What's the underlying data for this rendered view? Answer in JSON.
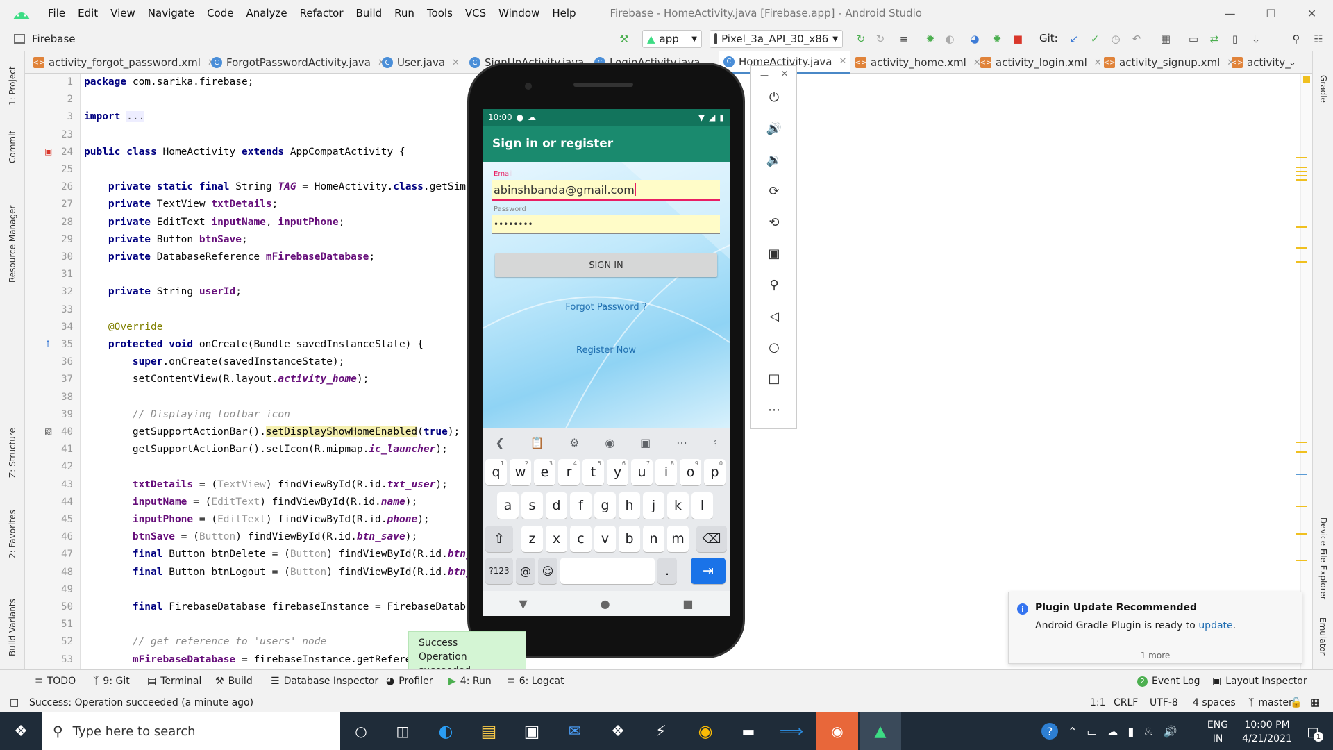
{
  "menubar": {
    "items": [
      "File",
      "Edit",
      "View",
      "Navigate",
      "Code",
      "Analyze",
      "Refactor",
      "Build",
      "Run",
      "Tools",
      "VCS",
      "Window",
      "Help"
    ],
    "title": "Firebase - HomeActivity.java [Firebase.app] - Android Studio"
  },
  "toolbar": {
    "project": "Firebase",
    "run_config": "app",
    "device": "Pixel_3a_API_30_x86",
    "git_label": "Git:"
  },
  "tabs": [
    {
      "label": "activity_forgot_password.xml",
      "type": "xml"
    },
    {
      "label": "ForgotPasswordActivity.java",
      "type": "java"
    },
    {
      "label": "User.java",
      "type": "java"
    },
    {
      "label": "SignUpActivity.java",
      "type": "java"
    },
    {
      "label": "LoginActivity.java",
      "type": "java"
    },
    {
      "label": "HomeActivity.java",
      "type": "java"
    },
    {
      "label": "activity_home.xml",
      "type": "xml"
    },
    {
      "label": "activity_login.xml",
      "type": "xml"
    },
    {
      "label": "activity_signup.xml",
      "type": "xml"
    },
    {
      "label": "activity_",
      "type": "xml"
    }
  ],
  "left_tools": [
    "1: Project",
    "Commit",
    "Resource Manager",
    "Z: Structure",
    "2: Favorites",
    "Build Variants"
  ],
  "right_tools": [
    "Gradle",
    "Device File Explorer",
    "Emulator"
  ],
  "code_lines": [
    {
      "n": "1",
      "html": "<span class='kw'>package</span> com.sarika.firebase;"
    },
    {
      "n": "2",
      "html": ""
    },
    {
      "n": "3",
      "html": "<span class='kw'>import</span> <span style='color:#555;background:#eef'>...</span>"
    },
    {
      "n": "23",
      "html": ""
    },
    {
      "n": "24",
      "html": "<span class='kw'>public class</span> HomeActivity <span class='kw'>extends</span> AppCompatActivity {"
    },
    {
      "n": "25",
      "html": ""
    },
    {
      "n": "26",
      "html": "    <span class='kw'>private static final</span> String <span class='it'>TAG</span> = HomeActivity.<span class='kw'>class</span>.getSimpleName();"
    },
    {
      "n": "27",
      "html": "    <span class='kw'>private</span> TextView <span class='fld'>txtDetails</span>;"
    },
    {
      "n": "28",
      "html": "    <span class='kw'>private</span> EditText <span class='fld'>inputName</span>, <span class='fld'>inputPhone</span>;"
    },
    {
      "n": "29",
      "html": "    <span class='kw'>private</span> Button <span class='fld'>btnSave</span>;"
    },
    {
      "n": "30",
      "html": "    <span class='kw'>private</span> DatabaseReference <span class='fld'>mFirebaseDatabase</span>;"
    },
    {
      "n": "31",
      "html": ""
    },
    {
      "n": "32",
      "html": "    <span class='kw'>private</span> String <span class='fld'>userId</span>;"
    },
    {
      "n": "33",
      "html": ""
    },
    {
      "n": "34",
      "html": "    <span class='an'>@Override</span>"
    },
    {
      "n": "35",
      "html": "    <span class='kw'>protected void</span> onCreate(Bundle savedInstanceState) {"
    },
    {
      "n": "36",
      "html": "        <span class='kw'>super</span>.onCreate(savedInstanceState);"
    },
    {
      "n": "37",
      "html": "        setContentView(R.layout.<span class='it'>activity_home</span>);"
    },
    {
      "n": "38",
      "html": ""
    },
    {
      "n": "39",
      "html": "        <span class='cm'>// Displaying toolbar icon</span>"
    },
    {
      "n": "40",
      "html": "        getSupportActionBar().<span style='background:#f5f0b0'>setDisplayShowHomeEnabled</span>(<span class='kw'>true</span>);"
    },
    {
      "n": "41",
      "html": "        getSupportActionBar().setIcon(R.mipmap.<span class='it'>ic_launcher</span>);"
    },
    {
      "n": "42",
      "html": ""
    },
    {
      "n": "43",
      "html": "        <span class='fld'>txtDetails</span> = (<span style='color:#999'>TextView</span>) findViewById(R.id.<span class='it'>txt_user</span>);"
    },
    {
      "n": "44",
      "html": "        <span class='fld'>inputName</span> = (<span style='color:#999'>EditText</span>) findViewById(R.id.<span class='it'>name</span>);"
    },
    {
      "n": "45",
      "html": "        <span class='fld'>inputPhone</span> = (<span style='color:#999'>EditText</span>) findViewById(R.id.<span class='it'>phone</span>);"
    },
    {
      "n": "46",
      "html": "        <span class='fld'>btnSave</span> = (<span style='color:#999'>Button</span>) findViewById(R.id.<span class='it'>btn_save</span>);"
    },
    {
      "n": "47",
      "html": "        <span class='kw'>final</span> Button btnDelete = (<span style='color:#999'>Button</span>) findViewById(R.id.<span class='it'>btn_delete</span>);"
    },
    {
      "n": "48",
      "html": "        <span class='kw'>final</span> Button btnLogout = (<span style='color:#999'>Button</span>) findViewById(R.id.<span class='it'>btn_logout</span>);"
    },
    {
      "n": "49",
      "html": ""
    },
    {
      "n": "50",
      "html": "        <span class='kw'>final</span> FirebaseDatabase firebaseInstance = FirebaseDatabase.getInstance();"
    },
    {
      "n": "51",
      "html": ""
    },
    {
      "n": "52",
      "html": "        <span class='cm'>// get reference to 'users' node</span>"
    },
    {
      "n": "53",
      "html": "        <span class='fld'>mFirebaseDatabase</span> = firebaseInstance.getReference(<span style='color:#008000;font-weight:bold'>\"users\"</span>);"
    }
  ],
  "phone": {
    "time": "10:00",
    "app_title": "Sign in or register",
    "email_label": "Email",
    "email_value": "abinshbanda@gmail.com",
    "password_label": "Password",
    "password_value": "••••••••",
    "signin_label": "SIGN IN",
    "forgot_label": "Forgot Password ?",
    "register_label": "Register Now",
    "accent": "#1a8a6e"
  },
  "keyboard": {
    "row1": [
      [
        "q",
        "1"
      ],
      [
        "w",
        "2"
      ],
      [
        "e",
        "3"
      ],
      [
        "r",
        "4"
      ],
      [
        "t",
        "5"
      ],
      [
        "y",
        "6"
      ],
      [
        "u",
        "7"
      ],
      [
        "i",
        "8"
      ],
      [
        "o",
        "9"
      ],
      [
        "p",
        "0"
      ]
    ],
    "row2": [
      "a",
      "s",
      "d",
      "f",
      "g",
      "h",
      "j",
      "k",
      "l"
    ],
    "row3": [
      "z",
      "x",
      "c",
      "v",
      "b",
      "n",
      "m"
    ],
    "sym_label": "?123",
    "at_label": "@",
    "dot_label": "."
  },
  "toast": {
    "line1": "Success",
    "line2": "Operation succeeded"
  },
  "notification": {
    "title": "Plugin Update Recommended",
    "body": "Android Gradle Plugin is ready to ",
    "link": "update",
    "body_end": ".",
    "more": "1 more"
  },
  "bottom_tools": [
    "TODO",
    "9: Git",
    "Terminal",
    "Build",
    "Database Inspector",
    "Profiler",
    "4: Run",
    "6: Logcat"
  ],
  "bottom_right_tools": [
    "Event Log",
    "Layout Inspector"
  ],
  "event_log_count": "2",
  "status": {
    "message": "Success: Operation succeeded (a minute ago)",
    "position": "1:1",
    "line_sep": "CRLF",
    "encoding": "UTF-8",
    "indent": "4 spaces",
    "branch": "master"
  },
  "taskbar": {
    "search_placeholder": "Type here to search",
    "lang1": "ENG",
    "lang2": "IN",
    "time": "10:00 PM",
    "date": "4/21/2021",
    "notif_count": "1"
  }
}
